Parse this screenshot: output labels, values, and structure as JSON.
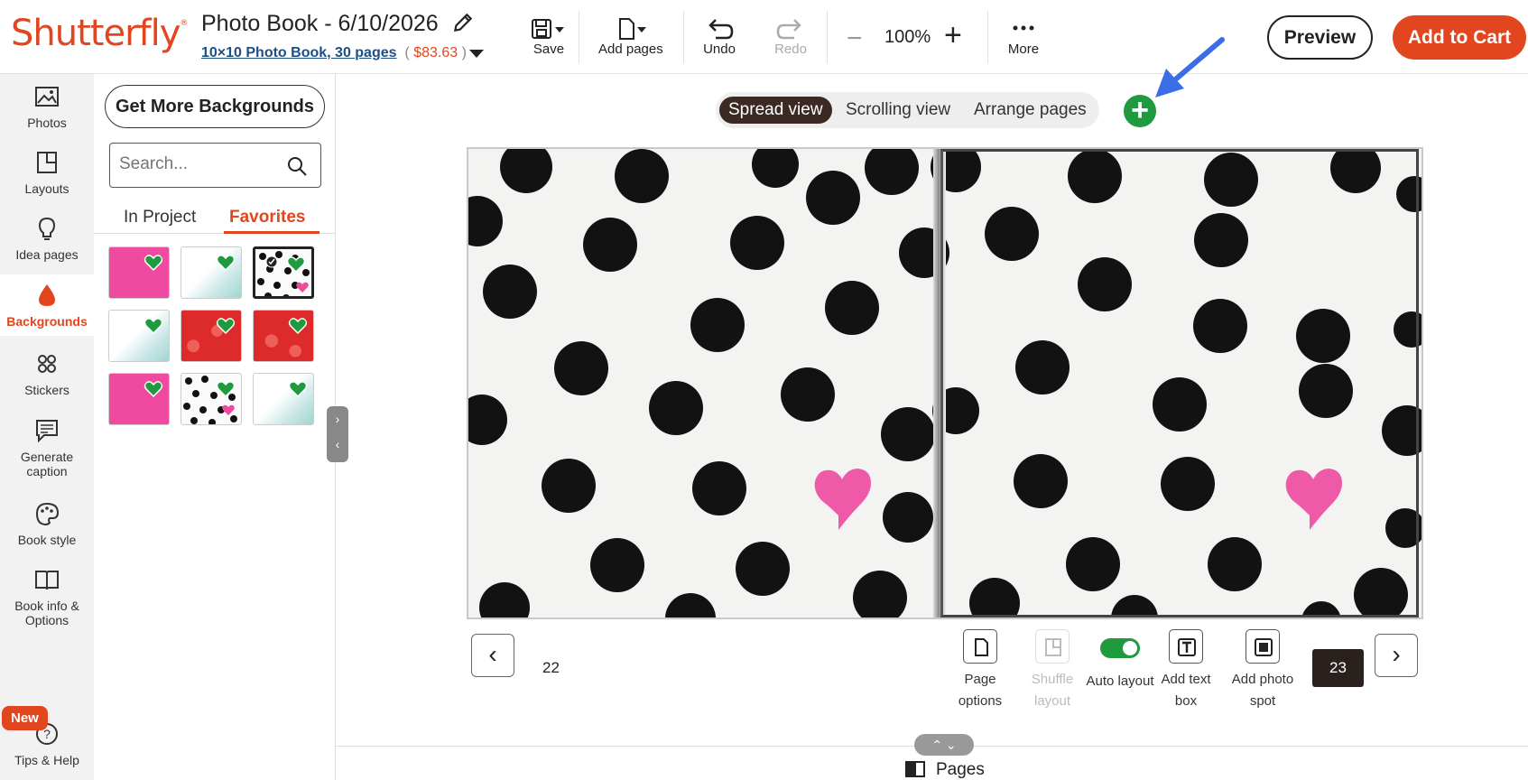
{
  "header": {
    "logo": "Shutterfly",
    "title": "Photo Book - 6/10/2026",
    "product_link": "10×10 Photo Book, 30 pages",
    "price": "$83.63",
    "paren_open": "(",
    "paren_close": ")"
  },
  "toolbar": {
    "save": "Save",
    "add_pages": "Add pages",
    "undo": "Undo",
    "redo": "Redo",
    "zoom": "100%",
    "more": "More"
  },
  "actions": {
    "preview": "Preview",
    "add_to_cart": "Add to Cart"
  },
  "leftnav": {
    "items": [
      {
        "label": "Photos",
        "icon": "image-icon"
      },
      {
        "label": "Layouts",
        "icon": "layout-icon"
      },
      {
        "label": "Idea pages",
        "icon": "lightbulb-icon"
      },
      {
        "label": "Backgrounds",
        "icon": "drop-icon"
      },
      {
        "label": "Stickers",
        "icon": "sticker-icon"
      },
      {
        "label": "Generate caption",
        "icon": "caption-icon"
      },
      {
        "label": "Book style",
        "icon": "palette-icon"
      },
      {
        "label": "Book info & Options",
        "icon": "book-icon"
      },
      {
        "label": "Tips & Help",
        "icon": "help-icon"
      }
    ],
    "badge": "New"
  },
  "panel": {
    "more_backgrounds": "Get More Backgrounds",
    "search_placeholder": "Search...",
    "tabs": [
      "In Project",
      "Favorites"
    ]
  },
  "view": {
    "options": [
      "Spread view",
      "Scrolling view",
      "Arrange pages"
    ],
    "active": "Spread view"
  },
  "spread": {
    "left_page": "22",
    "right_page": "23"
  },
  "page_tools": {
    "page_options": "Page options",
    "shuffle_layout": "Shuffle layout",
    "auto_layout": "Auto layout",
    "add_text_box": "Add text box",
    "add_photo_spot": "Add photo spot"
  },
  "footer": {
    "pages": "Pages"
  },
  "colors": {
    "brand": "#e1461f",
    "green": "#1f9a3f",
    "pink": "#ee4ba0"
  }
}
